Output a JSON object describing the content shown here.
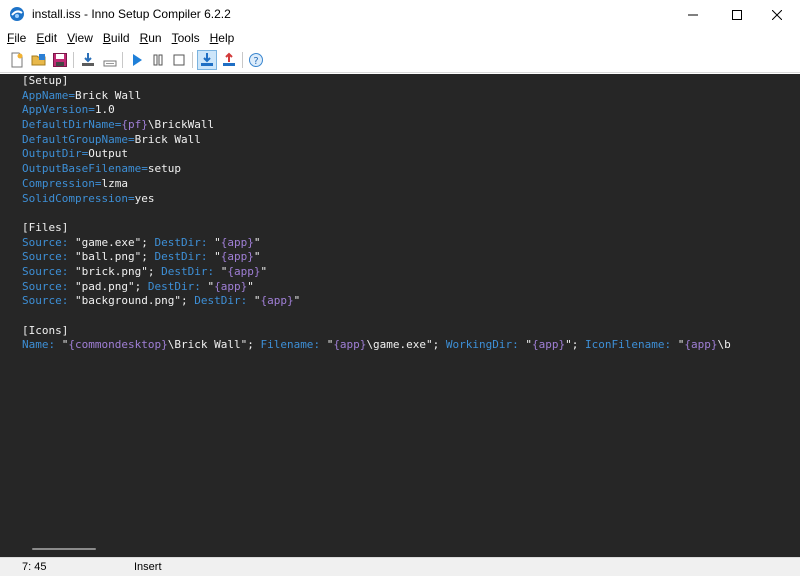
{
  "window": {
    "title": "install.iss - Inno Setup Compiler 6.2.2",
    "minimize_icon": "minimize-icon",
    "maximize_icon": "maximize-icon",
    "close_icon": "close-icon"
  },
  "menu": {
    "items": [
      {
        "label": "File",
        "underline": "F",
        "rest": "ile"
      },
      {
        "label": "Edit",
        "underline": "E",
        "rest": "dit"
      },
      {
        "label": "View",
        "underline": "V",
        "rest": "iew"
      },
      {
        "label": "Build",
        "underline": "B",
        "rest": "uild"
      },
      {
        "label": "Run",
        "underline": "R",
        "rest": "un"
      },
      {
        "label": "Tools",
        "underline": "T",
        "rest": "ools"
      },
      {
        "label": "Help",
        "underline": "H",
        "rest": "elp"
      }
    ]
  },
  "toolbar": {
    "buttons": [
      "new-file-icon",
      "open-file-icon",
      "save-icon",
      "compile-icon",
      "stop-compile-icon",
      "run-icon",
      "pause-icon",
      "stop-icon",
      "target-install-icon",
      "target-uninstall-icon",
      "help-icon"
    ]
  },
  "editor": {
    "lines": [
      [
        {
          "t": "[Setup]",
          "c": "sec"
        }
      ],
      [
        {
          "t": "AppName",
          "c": "key"
        },
        {
          "t": "=",
          "c": "op"
        },
        {
          "t": "Brick Wall",
          "c": "val"
        }
      ],
      [
        {
          "t": "AppVersion",
          "c": "key"
        },
        {
          "t": "=",
          "c": "op"
        },
        {
          "t": "1.0",
          "c": "val"
        }
      ],
      [
        {
          "t": "DefaultDirName",
          "c": "key"
        },
        {
          "t": "=",
          "c": "op"
        },
        {
          "t": "{pf}",
          "c": "cst"
        },
        {
          "t": "\\BrickWall",
          "c": "val"
        }
      ],
      [
        {
          "t": "DefaultGroupName",
          "c": "key"
        },
        {
          "t": "=",
          "c": "op"
        },
        {
          "t": "Brick Wall",
          "c": "val"
        }
      ],
      [
        {
          "t": "OutputDir",
          "c": "key"
        },
        {
          "t": "=",
          "c": "op"
        },
        {
          "t": "Output",
          "c": "val"
        }
      ],
      [
        {
          "t": "OutputBaseFilename",
          "c": "key"
        },
        {
          "t": "=",
          "c": "op"
        },
        {
          "t": "setup",
          "c": "val"
        }
      ],
      [
        {
          "t": "Compression",
          "c": "key"
        },
        {
          "t": "=",
          "c": "op"
        },
        {
          "t": "lzma",
          "c": "val"
        }
      ],
      [
        {
          "t": "SolidCompression",
          "c": "key"
        },
        {
          "t": "=",
          "c": "op"
        },
        {
          "t": "yes",
          "c": "val"
        }
      ],
      [],
      [
        {
          "t": "[Files]",
          "c": "sec"
        }
      ],
      [
        {
          "t": "Source",
          "c": "key"
        },
        {
          "t": ": ",
          "c": "op"
        },
        {
          "t": "\"game.exe\"",
          "c": "val"
        },
        {
          "t": "; ",
          "c": "sep"
        },
        {
          "t": "DestDir",
          "c": "key"
        },
        {
          "t": ": ",
          "c": "op"
        },
        {
          "t": "\"",
          "c": "val"
        },
        {
          "t": "{app}",
          "c": "cst"
        },
        {
          "t": "\"",
          "c": "val"
        }
      ],
      [
        {
          "t": "Source",
          "c": "key"
        },
        {
          "t": ": ",
          "c": "op"
        },
        {
          "t": "\"ball.png\"",
          "c": "val"
        },
        {
          "t": "; ",
          "c": "sep"
        },
        {
          "t": "DestDir",
          "c": "key"
        },
        {
          "t": ": ",
          "c": "op"
        },
        {
          "t": "\"",
          "c": "val"
        },
        {
          "t": "{app}",
          "c": "cst"
        },
        {
          "t": "\"",
          "c": "val"
        }
      ],
      [
        {
          "t": "Source",
          "c": "key"
        },
        {
          "t": ": ",
          "c": "op"
        },
        {
          "t": "\"brick.png\"",
          "c": "val"
        },
        {
          "t": "; ",
          "c": "sep"
        },
        {
          "t": "DestDir",
          "c": "key"
        },
        {
          "t": ": ",
          "c": "op"
        },
        {
          "t": "\"",
          "c": "val"
        },
        {
          "t": "{app}",
          "c": "cst"
        },
        {
          "t": "\"",
          "c": "val"
        }
      ],
      [
        {
          "t": "Source",
          "c": "key"
        },
        {
          "t": ": ",
          "c": "op"
        },
        {
          "t": "\"pad.png\"",
          "c": "val"
        },
        {
          "t": "; ",
          "c": "sep"
        },
        {
          "t": "DestDir",
          "c": "key"
        },
        {
          "t": ": ",
          "c": "op"
        },
        {
          "t": "\"",
          "c": "val"
        },
        {
          "t": "{app}",
          "c": "cst"
        },
        {
          "t": "\"",
          "c": "val"
        }
      ],
      [
        {
          "t": "Source",
          "c": "key"
        },
        {
          "t": ": ",
          "c": "op"
        },
        {
          "t": "\"background.png\"",
          "c": "val"
        },
        {
          "t": "; ",
          "c": "sep"
        },
        {
          "t": "DestDir",
          "c": "key"
        },
        {
          "t": ": ",
          "c": "op"
        },
        {
          "t": "\"",
          "c": "val"
        },
        {
          "t": "{app}",
          "c": "cst"
        },
        {
          "t": "\"",
          "c": "val"
        }
      ],
      [],
      [
        {
          "t": "[Icons]",
          "c": "sec"
        }
      ],
      [
        {
          "t": "Name",
          "c": "key"
        },
        {
          "t": ": ",
          "c": "op"
        },
        {
          "t": "\"",
          "c": "val"
        },
        {
          "t": "{commondesktop}",
          "c": "cst"
        },
        {
          "t": "\\Brick Wall\"",
          "c": "val"
        },
        {
          "t": "; ",
          "c": "sep"
        },
        {
          "t": "Filename",
          "c": "key"
        },
        {
          "t": ": ",
          "c": "op"
        },
        {
          "t": "\"",
          "c": "val"
        },
        {
          "t": "{app}",
          "c": "cst"
        },
        {
          "t": "\\game.exe\"",
          "c": "val"
        },
        {
          "t": "; ",
          "c": "sep"
        },
        {
          "t": "WorkingDir",
          "c": "key"
        },
        {
          "t": ": ",
          "c": "op"
        },
        {
          "t": "\"",
          "c": "val"
        },
        {
          "t": "{app}",
          "c": "cst"
        },
        {
          "t": "\"",
          "c": "val"
        },
        {
          "t": "; ",
          "c": "sep"
        },
        {
          "t": "IconFilename",
          "c": "key"
        },
        {
          "t": ": ",
          "c": "op"
        },
        {
          "t": "\"",
          "c": "val"
        },
        {
          "t": "{app}",
          "c": "cst"
        },
        {
          "t": "\\b",
          "c": "val"
        }
      ]
    ]
  },
  "status": {
    "position": "7:  45",
    "mode": "Insert"
  },
  "colors": {
    "editor_bg": "#262626",
    "key": "#3d8fd6",
    "constant": "#a07fd6",
    "text": "#f0f0f0"
  }
}
